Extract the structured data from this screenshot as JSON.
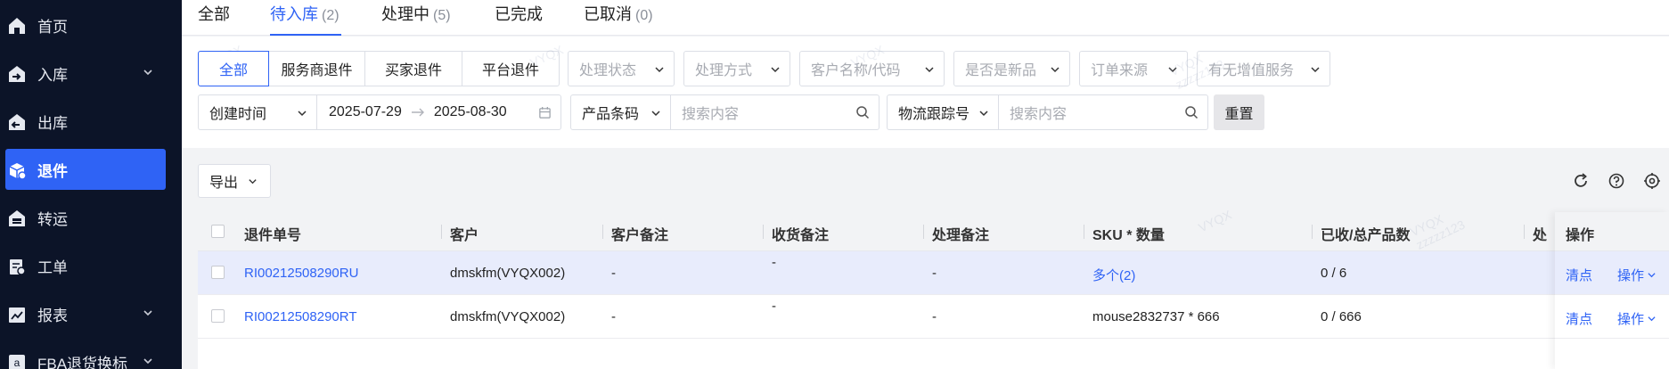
{
  "sidebar": {
    "items": [
      {
        "label": "首页",
        "icon": "home-icon",
        "has_arrow": false,
        "active": false
      },
      {
        "label": "入库",
        "icon": "inbound-icon",
        "has_arrow": true,
        "active": false
      },
      {
        "label": "出库",
        "icon": "outbound-icon",
        "has_arrow": false,
        "active": false
      },
      {
        "label": "退件",
        "icon": "return-icon",
        "has_arrow": false,
        "active": true
      },
      {
        "label": "转运",
        "icon": "transfer-icon",
        "has_arrow": false,
        "active": false
      },
      {
        "label": "工单",
        "icon": "ticket-icon",
        "has_arrow": false,
        "active": false
      },
      {
        "label": "报表",
        "icon": "report-icon",
        "has_arrow": true,
        "active": false
      },
      {
        "label": "FBA退货换标",
        "icon": "amazon-icon",
        "has_arrow": true,
        "active": false
      }
    ]
  },
  "tabs": [
    {
      "label": "全部",
      "count": ""
    },
    {
      "label": "待入库",
      "count": "(2)"
    },
    {
      "label": "处理中",
      "count": "(5)"
    },
    {
      "label": "已完成",
      "count": ""
    },
    {
      "label": "已取消",
      "count": "(0)"
    }
  ],
  "filters": {
    "return_types": [
      "全部",
      "服务商退件",
      "买家退件",
      "平台退件"
    ],
    "dropdowns": [
      "处理状态",
      "处理方式",
      "客户名称/代码",
      "是否是新品",
      "订单来源",
      "有无增值服务"
    ],
    "date_type": "创建时间",
    "date_start": "2025-07-29",
    "date_end": "2025-08-30",
    "search1_type": "产品条码",
    "search1_placeholder": "搜索内容",
    "search2_type": "物流跟踪号",
    "search2_placeholder": "搜索内容",
    "reset_label": "重置"
  },
  "toolbar": {
    "export_label": "导出"
  },
  "table": {
    "columns": [
      "退件单号",
      "客户",
      "客户备注",
      "收货备注",
      "处理备注",
      "SKU * 数量",
      "已收/总产品数",
      "处",
      "操作"
    ],
    "rows": [
      {
        "return_no": "RI00212508290RU",
        "customer": "dmskfm(VYQX002)",
        "customer_note": "-",
        "receive_note": "-",
        "process_note": "-",
        "sku": "多个(2)",
        "received": "0 / 6",
        "action1": "清点",
        "action2": "操作"
      },
      {
        "return_no": "RI00212508290RT",
        "customer": "dmskfm(VYQX002)",
        "customer_note": "-",
        "receive_note": "-",
        "process_note": "-",
        "sku": "mouse2832737 * 666",
        "received": "0 / 666",
        "action1": "清点",
        "action2": "操作"
      }
    ]
  },
  "watermark": {
    "line1": "VYQX",
    "line2": "zzzzz123"
  },
  "colors": {
    "accent": "#2f63f5",
    "sidebar_bg": "#0c1428",
    "row_highlight": "#e8ecfc"
  }
}
